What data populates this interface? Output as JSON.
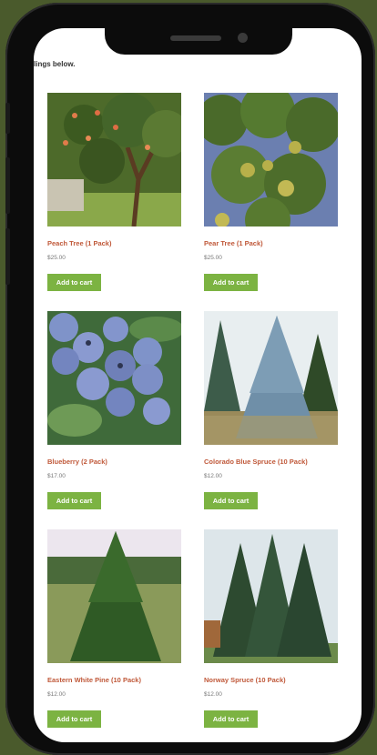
{
  "intro_text": "lings below.",
  "products": [
    {
      "name": "Peach Tree (1 Pack)",
      "price": "$25.00",
      "button": "Add to cart",
      "image_icon": "peach-tree-photo"
    },
    {
      "name": "Pear Tree (1 Pack)",
      "price": "$25.00",
      "button": "Add to cart",
      "image_icon": "pear-tree-photo"
    },
    {
      "name": "Blueberry (2 Pack)",
      "price": "$17.00",
      "button": "Add to cart",
      "image_icon": "blueberry-photo"
    },
    {
      "name": "Colorado Blue Spruce (10 Pack)",
      "price": "$12.00",
      "button": "Add to cart",
      "image_icon": "blue-spruce-photo"
    },
    {
      "name": "Eastern White Pine (10 Pack)",
      "price": "$12.00",
      "button": "Add to cart",
      "image_icon": "white-pine-photo"
    },
    {
      "name": "Norway Spruce (10 Pack)",
      "price": "$12.00",
      "button": "Add to cart",
      "image_icon": "norway-spruce-photo"
    }
  ],
  "colors": {
    "accent": "#7cb342",
    "product_title": "#c0593a",
    "price": "#777777",
    "frame": "#0c0c0c",
    "background": "#4a5a2c"
  }
}
